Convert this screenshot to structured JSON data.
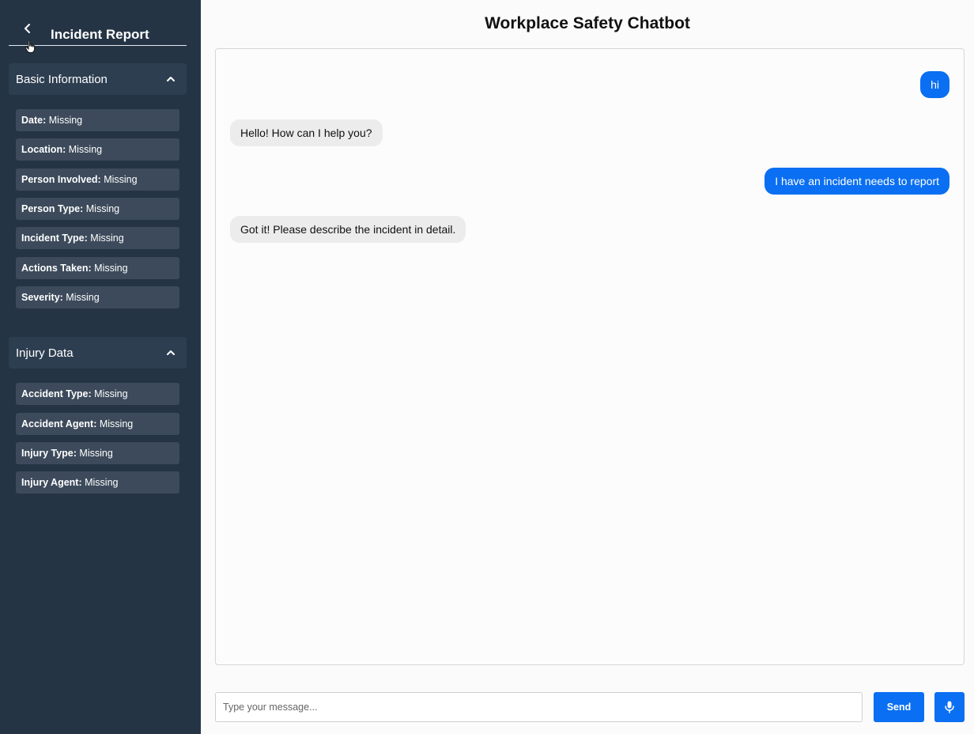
{
  "sidebar": {
    "title": "Incident Report",
    "sections": [
      {
        "label": "Basic Information",
        "fields": [
          {
            "key": "Date:",
            "value": "Missing"
          },
          {
            "key": "Location:",
            "value": "Missing"
          },
          {
            "key": "Person Involved:",
            "value": "Missing"
          },
          {
            "key": "Person Type:",
            "value": "Missing"
          },
          {
            "key": "Incident Type:",
            "value": "Missing"
          },
          {
            "key": "Actions Taken:",
            "value": "Missing"
          },
          {
            "key": "Severity:",
            "value": "Missing"
          }
        ]
      },
      {
        "label": "Injury Data",
        "fields": [
          {
            "key": "Accident Type:",
            "value": "Missing"
          },
          {
            "key": "Accident Agent:",
            "value": "Missing"
          },
          {
            "key": "Injury Type:",
            "value": "Missing"
          },
          {
            "key": "Injury Agent:",
            "value": "Missing"
          }
        ]
      }
    ]
  },
  "main": {
    "title": "Workplace Safety Chatbot",
    "messages": [
      {
        "role": "user",
        "text": "hi"
      },
      {
        "role": "bot",
        "text": "Hello! How can I help you?"
      },
      {
        "role": "user",
        "text": "I have an incident needs to report"
      },
      {
        "role": "bot",
        "text": "Got it! Please describe the incident in detail."
      }
    ],
    "input": {
      "placeholder": "Type your message...",
      "value": ""
    },
    "send_label": "Send"
  },
  "icons": {
    "back": "chevron-left-icon",
    "collapse": "chevron-up-icon",
    "mic": "microphone-icon",
    "cursor": "hand-pointer-icon"
  },
  "colors": {
    "sidebar_bg": "#253445",
    "section_bg": "#2e3e51",
    "field_bg": "#3c4a5b",
    "accent": "#0a6ff2",
    "bot_bubble": "#ececec"
  }
}
